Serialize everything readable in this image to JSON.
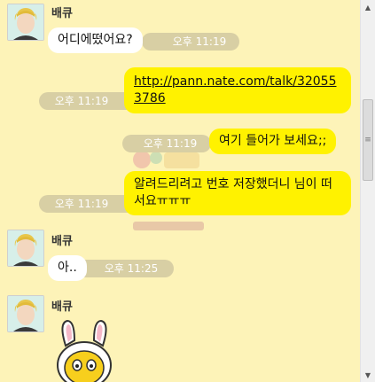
{
  "messages": [
    {
      "sender": "배큐",
      "text": "어디에떴어요?",
      "time": "오후 11:19"
    },
    {
      "text": "http://pann.nate.com/talk/320553786",
      "time": "오후 11:19"
    },
    {
      "text": "여기 들어가 보세요;;",
      "time": "오후 11:19"
    },
    {
      "text": "알려드리려고 번호 저장했더니 님이 떠서요ㅠㅠㅠ",
      "time": "오후 11:19"
    },
    {
      "sender": "배큐",
      "text": "아..",
      "time": "오후 11:25"
    },
    {
      "sender": "배큐",
      "sticker": "rabbit-hood-sticker"
    }
  ],
  "colors": {
    "background": "#fdf3b8",
    "outgoing_bubble": "#fff200",
    "incoming_bubble": "#ffffff",
    "time_pill": "#d8cfa4"
  },
  "scrollbar": {
    "up_icon": "triangle-up",
    "down_icon": "triangle-down",
    "grip_icon": "grip-lines"
  }
}
